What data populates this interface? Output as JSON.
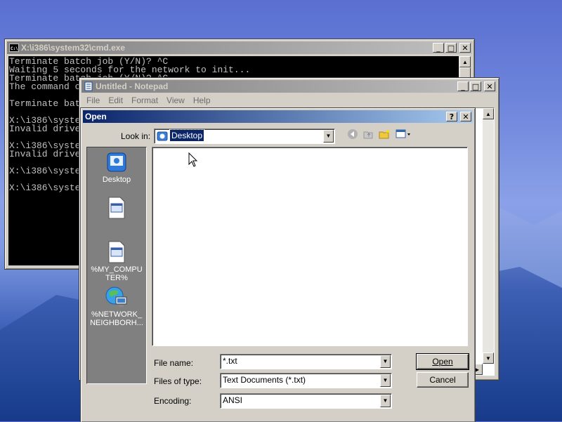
{
  "colors": {
    "active_title_start": "#0a246a",
    "active_title_end": "#a6caf0",
    "inactive_title": "#808080",
    "selection": "#0a246a"
  },
  "cmd": {
    "title": "X:\\i386\\system32\\cmd.exe",
    "icon": "cmd-icon",
    "lines": [
      "Terminate batch job (Y/N)? ^C",
      "Waiting 5 seconds for the network to init...",
      "Terminate batch job (Y/N)? ^C",
      "The command c",
      "",
      "Terminate bat",
      "",
      "X:\\i386\\syste",
      "Invalid drive",
      "",
      "X:\\i386\\syste",
      "Invalid drive",
      "",
      "X:\\i386\\syste",
      "",
      "X:\\i386\\syste"
    ]
  },
  "notepad": {
    "title": "Untitled - Notepad",
    "icon": "notepad-icon",
    "menu": [
      "File",
      "Edit",
      "Format",
      "View",
      "Help"
    ]
  },
  "dialog": {
    "title": "Open",
    "look_in_label": "Look in:",
    "look_in_value": "Desktop",
    "places": [
      {
        "label": "Desktop",
        "icon": "desktop-icon"
      },
      {
        "label": "",
        "icon": "document-icon"
      },
      {
        "label": "%MY_COMPUTER%",
        "icon": "document-icon"
      },
      {
        "label": "%NETWORK_NEIGHBORH...",
        "icon": "network-icon"
      }
    ],
    "file_name_label": "File name:",
    "file_name_value": "*.txt",
    "files_of_type_label": "Files of type:",
    "files_of_type_value": "Text Documents (*.txt)",
    "encoding_label": "Encoding:",
    "encoding_value": "ANSI",
    "open_button": "Open",
    "cancel_button": "Cancel",
    "help_button": "?",
    "close_button": "✕"
  }
}
